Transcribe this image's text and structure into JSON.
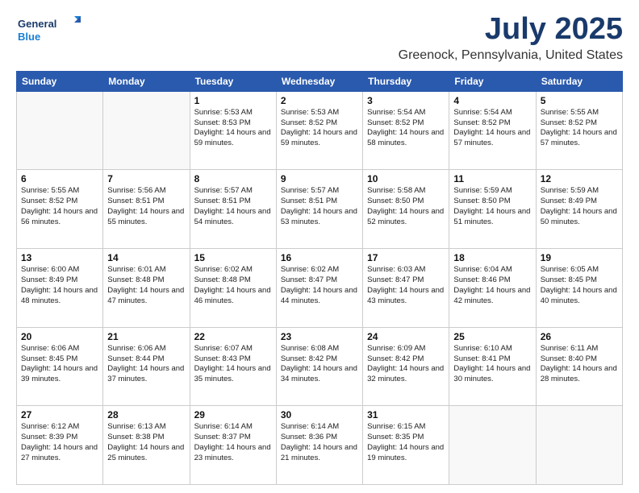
{
  "header": {
    "logo_line1": "General",
    "logo_line2": "Blue",
    "title": "July 2025",
    "subtitle": "Greenock, Pennsylvania, United States"
  },
  "days_of_week": [
    "Sunday",
    "Monday",
    "Tuesday",
    "Wednesday",
    "Thursday",
    "Friday",
    "Saturday"
  ],
  "weeks": [
    [
      {
        "day": "",
        "info": ""
      },
      {
        "day": "",
        "info": ""
      },
      {
        "day": "1",
        "info": "Sunrise: 5:53 AM\nSunset: 8:53 PM\nDaylight: 14 hours and 59 minutes."
      },
      {
        "day": "2",
        "info": "Sunrise: 5:53 AM\nSunset: 8:52 PM\nDaylight: 14 hours and 59 minutes."
      },
      {
        "day": "3",
        "info": "Sunrise: 5:54 AM\nSunset: 8:52 PM\nDaylight: 14 hours and 58 minutes."
      },
      {
        "day": "4",
        "info": "Sunrise: 5:54 AM\nSunset: 8:52 PM\nDaylight: 14 hours and 57 minutes."
      },
      {
        "day": "5",
        "info": "Sunrise: 5:55 AM\nSunset: 8:52 PM\nDaylight: 14 hours and 57 minutes."
      }
    ],
    [
      {
        "day": "6",
        "info": "Sunrise: 5:55 AM\nSunset: 8:52 PM\nDaylight: 14 hours and 56 minutes."
      },
      {
        "day": "7",
        "info": "Sunrise: 5:56 AM\nSunset: 8:51 PM\nDaylight: 14 hours and 55 minutes."
      },
      {
        "day": "8",
        "info": "Sunrise: 5:57 AM\nSunset: 8:51 PM\nDaylight: 14 hours and 54 minutes."
      },
      {
        "day": "9",
        "info": "Sunrise: 5:57 AM\nSunset: 8:51 PM\nDaylight: 14 hours and 53 minutes."
      },
      {
        "day": "10",
        "info": "Sunrise: 5:58 AM\nSunset: 8:50 PM\nDaylight: 14 hours and 52 minutes."
      },
      {
        "day": "11",
        "info": "Sunrise: 5:59 AM\nSunset: 8:50 PM\nDaylight: 14 hours and 51 minutes."
      },
      {
        "day": "12",
        "info": "Sunrise: 5:59 AM\nSunset: 8:49 PM\nDaylight: 14 hours and 50 minutes."
      }
    ],
    [
      {
        "day": "13",
        "info": "Sunrise: 6:00 AM\nSunset: 8:49 PM\nDaylight: 14 hours and 48 minutes."
      },
      {
        "day": "14",
        "info": "Sunrise: 6:01 AM\nSunset: 8:48 PM\nDaylight: 14 hours and 47 minutes."
      },
      {
        "day": "15",
        "info": "Sunrise: 6:02 AM\nSunset: 8:48 PM\nDaylight: 14 hours and 46 minutes."
      },
      {
        "day": "16",
        "info": "Sunrise: 6:02 AM\nSunset: 8:47 PM\nDaylight: 14 hours and 44 minutes."
      },
      {
        "day": "17",
        "info": "Sunrise: 6:03 AM\nSunset: 8:47 PM\nDaylight: 14 hours and 43 minutes."
      },
      {
        "day": "18",
        "info": "Sunrise: 6:04 AM\nSunset: 8:46 PM\nDaylight: 14 hours and 42 minutes."
      },
      {
        "day": "19",
        "info": "Sunrise: 6:05 AM\nSunset: 8:45 PM\nDaylight: 14 hours and 40 minutes."
      }
    ],
    [
      {
        "day": "20",
        "info": "Sunrise: 6:06 AM\nSunset: 8:45 PM\nDaylight: 14 hours and 39 minutes."
      },
      {
        "day": "21",
        "info": "Sunrise: 6:06 AM\nSunset: 8:44 PM\nDaylight: 14 hours and 37 minutes."
      },
      {
        "day": "22",
        "info": "Sunrise: 6:07 AM\nSunset: 8:43 PM\nDaylight: 14 hours and 35 minutes."
      },
      {
        "day": "23",
        "info": "Sunrise: 6:08 AM\nSunset: 8:42 PM\nDaylight: 14 hours and 34 minutes."
      },
      {
        "day": "24",
        "info": "Sunrise: 6:09 AM\nSunset: 8:42 PM\nDaylight: 14 hours and 32 minutes."
      },
      {
        "day": "25",
        "info": "Sunrise: 6:10 AM\nSunset: 8:41 PM\nDaylight: 14 hours and 30 minutes."
      },
      {
        "day": "26",
        "info": "Sunrise: 6:11 AM\nSunset: 8:40 PM\nDaylight: 14 hours and 28 minutes."
      }
    ],
    [
      {
        "day": "27",
        "info": "Sunrise: 6:12 AM\nSunset: 8:39 PM\nDaylight: 14 hours and 27 minutes."
      },
      {
        "day": "28",
        "info": "Sunrise: 6:13 AM\nSunset: 8:38 PM\nDaylight: 14 hours and 25 minutes."
      },
      {
        "day": "29",
        "info": "Sunrise: 6:14 AM\nSunset: 8:37 PM\nDaylight: 14 hours and 23 minutes."
      },
      {
        "day": "30",
        "info": "Sunrise: 6:14 AM\nSunset: 8:36 PM\nDaylight: 14 hours and 21 minutes."
      },
      {
        "day": "31",
        "info": "Sunrise: 6:15 AM\nSunset: 8:35 PM\nDaylight: 14 hours and 19 minutes."
      },
      {
        "day": "",
        "info": ""
      },
      {
        "day": "",
        "info": ""
      }
    ]
  ]
}
